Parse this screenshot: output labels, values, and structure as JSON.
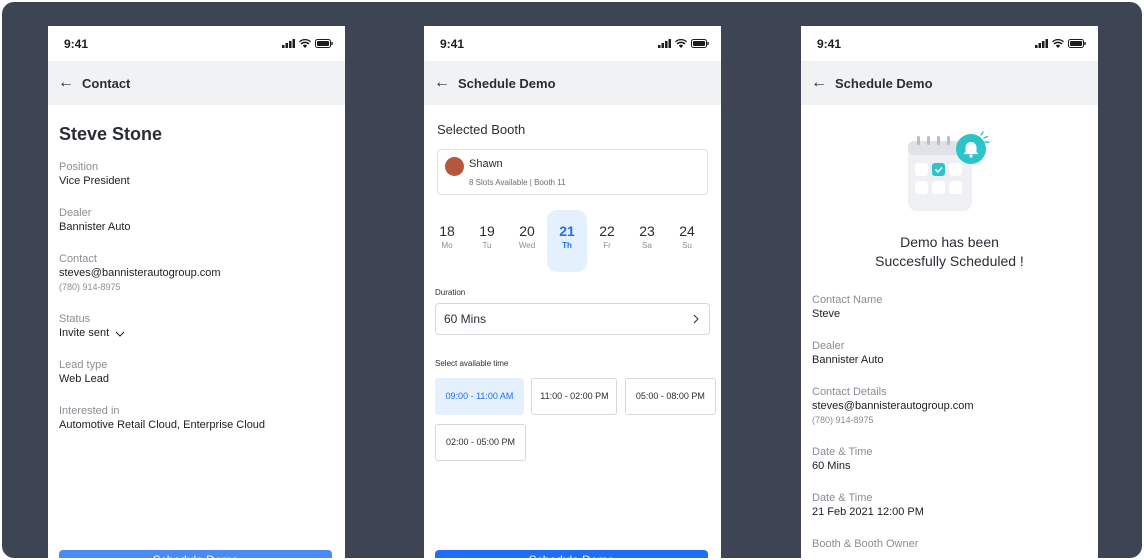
{
  "screens": [
    {
      "status_time": "9:41",
      "appbar_title": "Contact",
      "contact_name": "Steve Stone",
      "fields": [
        {
          "label": "Position",
          "value": "Vice President"
        },
        {
          "label": "Dealer",
          "value": "Bannister Auto"
        },
        {
          "label": "Contact",
          "value": "steves@bannisterautogroup.com",
          "sub": "(780) 914-8975"
        },
        {
          "label": "Status",
          "value": "Invite sent"
        },
        {
          "label": "Lead type",
          "value": "Web Lead"
        },
        {
          "label": "Interested in",
          "value": "Automotive Retail Cloud, Enterprise Cloud"
        }
      ],
      "button_label": "Schedule Demo"
    },
    {
      "status_time": "9:41",
      "appbar_title": "Schedule Demo",
      "section_title": "Selected Booth",
      "booth": {
        "owner": "Shawn",
        "details": "8 Slots Available | Booth 11"
      },
      "dates": [
        {
          "day": "18",
          "weekday": "Mo"
        },
        {
          "day": "19",
          "weekday": "Tu"
        },
        {
          "day": "20",
          "weekday": "Wed"
        },
        {
          "day": "21",
          "weekday": "Th",
          "selected": true
        },
        {
          "day": "22",
          "weekday": "Fr"
        },
        {
          "day": "23",
          "weekday": "Sa"
        },
        {
          "day": "24",
          "weekday": "Su"
        }
      ],
      "duration_label": "Duration",
      "duration_value": "60 Mins",
      "time_label": "Select available time",
      "time_slots": [
        {
          "label": "09:00 - 11:00 AM",
          "selected": true
        },
        {
          "label": "11:00 - 02:00 PM"
        },
        {
          "label": "05:00 - 08:00 PM"
        },
        {
          "label": "02:00 - 05:00 PM"
        }
      ],
      "button_label": "Schedule Demo"
    },
    {
      "status_time": "9:41",
      "appbar_title": "Schedule Demo",
      "success_line1": "Demo has been",
      "success_line2": "Succesfully Scheduled !",
      "fields": [
        {
          "label": "Contact Name",
          "value": "Steve"
        },
        {
          "label": "Dealer",
          "value": "Bannister Auto"
        },
        {
          "label": "Contact Details",
          "value": "steves@bannisterautogroup.com",
          "sub": "(780) 914-8975"
        },
        {
          "label": "Date & Time",
          "value": "60 Mins"
        },
        {
          "label": "Date & Time",
          "value": "21 Feb 2021 12:00 PM"
        },
        {
          "label": "Booth & Booth Owner",
          "value": ""
        }
      ]
    }
  ],
  "icons": {
    "back": "arrow-left-icon",
    "signal": "signal-icon",
    "wifi": "wifi-icon",
    "battery": "battery-icon",
    "chevron_down": "chevron-down-icon",
    "chevron_right": "chevron-right-icon",
    "calendar_bell": "calendar-bell-icon"
  },
  "colors": {
    "background": "#3d4453",
    "accent": "#1f6ef7",
    "selected_bg": "#e5f0fd",
    "teal": "#2cc4c9",
    "button_light": "#4a8af5"
  }
}
